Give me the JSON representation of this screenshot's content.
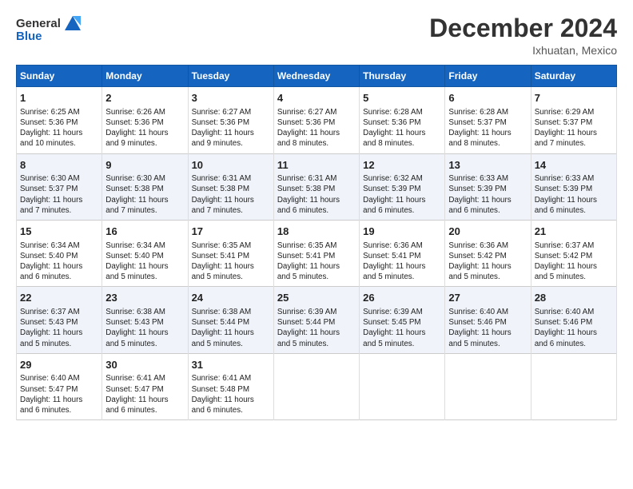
{
  "header": {
    "logo_line1": "General",
    "logo_line2": "Blue",
    "month": "December 2024",
    "location": "Ixhuatan, Mexico"
  },
  "weekdays": [
    "Sunday",
    "Monday",
    "Tuesday",
    "Wednesday",
    "Thursday",
    "Friday",
    "Saturday"
  ],
  "weeks": [
    [
      {
        "day": "1",
        "lines": [
          "Sunrise: 6:25 AM",
          "Sunset: 5:36 PM",
          "Daylight: 11 hours",
          "and 10 minutes."
        ]
      },
      {
        "day": "2",
        "lines": [
          "Sunrise: 6:26 AM",
          "Sunset: 5:36 PM",
          "Daylight: 11 hours",
          "and 9 minutes."
        ]
      },
      {
        "day": "3",
        "lines": [
          "Sunrise: 6:27 AM",
          "Sunset: 5:36 PM",
          "Daylight: 11 hours",
          "and 9 minutes."
        ]
      },
      {
        "day": "4",
        "lines": [
          "Sunrise: 6:27 AM",
          "Sunset: 5:36 PM",
          "Daylight: 11 hours",
          "and 8 minutes."
        ]
      },
      {
        "day": "5",
        "lines": [
          "Sunrise: 6:28 AM",
          "Sunset: 5:36 PM",
          "Daylight: 11 hours",
          "and 8 minutes."
        ]
      },
      {
        "day": "6",
        "lines": [
          "Sunrise: 6:28 AM",
          "Sunset: 5:37 PM",
          "Daylight: 11 hours",
          "and 8 minutes."
        ]
      },
      {
        "day": "7",
        "lines": [
          "Sunrise: 6:29 AM",
          "Sunset: 5:37 PM",
          "Daylight: 11 hours",
          "and 7 minutes."
        ]
      }
    ],
    [
      {
        "day": "8",
        "lines": [
          "Sunrise: 6:30 AM",
          "Sunset: 5:37 PM",
          "Daylight: 11 hours",
          "and 7 minutes."
        ]
      },
      {
        "day": "9",
        "lines": [
          "Sunrise: 6:30 AM",
          "Sunset: 5:38 PM",
          "Daylight: 11 hours",
          "and 7 minutes."
        ]
      },
      {
        "day": "10",
        "lines": [
          "Sunrise: 6:31 AM",
          "Sunset: 5:38 PM",
          "Daylight: 11 hours",
          "and 7 minutes."
        ]
      },
      {
        "day": "11",
        "lines": [
          "Sunrise: 6:31 AM",
          "Sunset: 5:38 PM",
          "Daylight: 11 hours",
          "and 6 minutes."
        ]
      },
      {
        "day": "12",
        "lines": [
          "Sunrise: 6:32 AM",
          "Sunset: 5:39 PM",
          "Daylight: 11 hours",
          "and 6 minutes."
        ]
      },
      {
        "day": "13",
        "lines": [
          "Sunrise: 6:33 AM",
          "Sunset: 5:39 PM",
          "Daylight: 11 hours",
          "and 6 minutes."
        ]
      },
      {
        "day": "14",
        "lines": [
          "Sunrise: 6:33 AM",
          "Sunset: 5:39 PM",
          "Daylight: 11 hours",
          "and 6 minutes."
        ]
      }
    ],
    [
      {
        "day": "15",
        "lines": [
          "Sunrise: 6:34 AM",
          "Sunset: 5:40 PM",
          "Daylight: 11 hours",
          "and 6 minutes."
        ]
      },
      {
        "day": "16",
        "lines": [
          "Sunrise: 6:34 AM",
          "Sunset: 5:40 PM",
          "Daylight: 11 hours",
          "and 5 minutes."
        ]
      },
      {
        "day": "17",
        "lines": [
          "Sunrise: 6:35 AM",
          "Sunset: 5:41 PM",
          "Daylight: 11 hours",
          "and 5 minutes."
        ]
      },
      {
        "day": "18",
        "lines": [
          "Sunrise: 6:35 AM",
          "Sunset: 5:41 PM",
          "Daylight: 11 hours",
          "and 5 minutes."
        ]
      },
      {
        "day": "19",
        "lines": [
          "Sunrise: 6:36 AM",
          "Sunset: 5:41 PM",
          "Daylight: 11 hours",
          "and 5 minutes."
        ]
      },
      {
        "day": "20",
        "lines": [
          "Sunrise: 6:36 AM",
          "Sunset: 5:42 PM",
          "Daylight: 11 hours",
          "and 5 minutes."
        ]
      },
      {
        "day": "21",
        "lines": [
          "Sunrise: 6:37 AM",
          "Sunset: 5:42 PM",
          "Daylight: 11 hours",
          "and 5 minutes."
        ]
      }
    ],
    [
      {
        "day": "22",
        "lines": [
          "Sunrise: 6:37 AM",
          "Sunset: 5:43 PM",
          "Daylight: 11 hours",
          "and 5 minutes."
        ]
      },
      {
        "day": "23",
        "lines": [
          "Sunrise: 6:38 AM",
          "Sunset: 5:43 PM",
          "Daylight: 11 hours",
          "and 5 minutes."
        ]
      },
      {
        "day": "24",
        "lines": [
          "Sunrise: 6:38 AM",
          "Sunset: 5:44 PM",
          "Daylight: 11 hours",
          "and 5 minutes."
        ]
      },
      {
        "day": "25",
        "lines": [
          "Sunrise: 6:39 AM",
          "Sunset: 5:44 PM",
          "Daylight: 11 hours",
          "and 5 minutes."
        ]
      },
      {
        "day": "26",
        "lines": [
          "Sunrise: 6:39 AM",
          "Sunset: 5:45 PM",
          "Daylight: 11 hours",
          "and 5 minutes."
        ]
      },
      {
        "day": "27",
        "lines": [
          "Sunrise: 6:40 AM",
          "Sunset: 5:46 PM",
          "Daylight: 11 hours",
          "and 5 minutes."
        ]
      },
      {
        "day": "28",
        "lines": [
          "Sunrise: 6:40 AM",
          "Sunset: 5:46 PM",
          "Daylight: 11 hours",
          "and 6 minutes."
        ]
      }
    ],
    [
      {
        "day": "29",
        "lines": [
          "Sunrise: 6:40 AM",
          "Sunset: 5:47 PM",
          "Daylight: 11 hours",
          "and 6 minutes."
        ]
      },
      {
        "day": "30",
        "lines": [
          "Sunrise: 6:41 AM",
          "Sunset: 5:47 PM",
          "Daylight: 11 hours",
          "and 6 minutes."
        ]
      },
      {
        "day": "31",
        "lines": [
          "Sunrise: 6:41 AM",
          "Sunset: 5:48 PM",
          "Daylight: 11 hours",
          "and 6 minutes."
        ]
      },
      {
        "day": "",
        "lines": []
      },
      {
        "day": "",
        "lines": []
      },
      {
        "day": "",
        "lines": []
      },
      {
        "day": "",
        "lines": []
      }
    ]
  ]
}
